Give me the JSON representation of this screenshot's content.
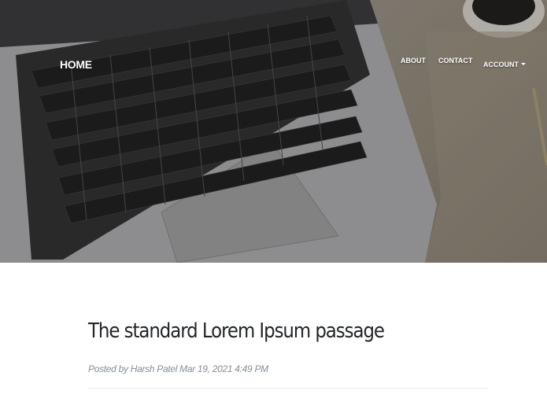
{
  "nav": {
    "brand": "HOME",
    "about": "ABOUT",
    "contact": "CONTACT",
    "account": "ACCOUNT"
  },
  "hero": {
    "image_subject": "laptop-keyboard-on-desk-photo"
  },
  "post": {
    "title": "The standard Lorem Ipsum passage",
    "meta": "Posted by Harsh Patel Mar 19, 2021 4:49 PM"
  },
  "colors": {
    "title_text": "#212529",
    "meta_text": "#868e96",
    "nav_text": "#ffffff",
    "divider": "#e9ecef"
  },
  "icons": {
    "account_dropdown": "caret-down-icon"
  }
}
